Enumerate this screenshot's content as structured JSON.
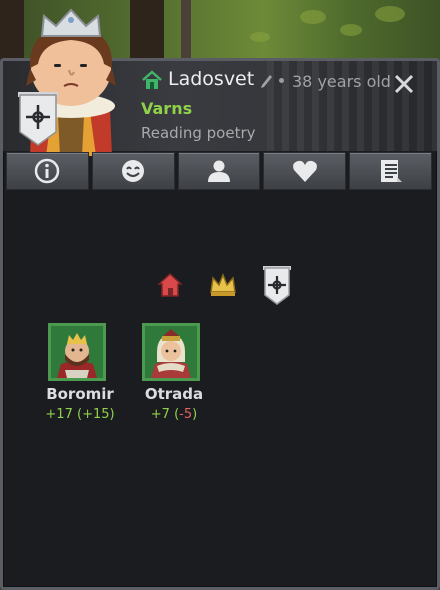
{
  "character": {
    "name": "Ladosvet",
    "age": "38 years old",
    "dynasty": "Varns",
    "activity": "Reading poetry"
  },
  "tabs": [
    {
      "icon": "info-icon"
    },
    {
      "icon": "mood-icon"
    },
    {
      "icon": "person-icon"
    },
    {
      "icon": "heart-icon"
    },
    {
      "icon": "scroll-icon"
    }
  ],
  "filters": [
    {
      "icon": "house-icon",
      "color": "#d9484a"
    },
    {
      "icon": "crown-icon",
      "color": "#e8c14a"
    },
    {
      "icon": "banner-icon",
      "color": "#e9eaec"
    }
  ],
  "members": [
    {
      "name": "Boromir",
      "score": "+17",
      "modifier_open": "(",
      "modifier": "+15",
      "modifier_close": ")",
      "modifier_color": "#8fd24a"
    },
    {
      "name": "Otrada",
      "score": "+7",
      "modifier_open": "(",
      "modifier": "-5",
      "modifier_close": ")",
      "modifier_color": "#e06262"
    }
  ],
  "colors": {
    "dynasty": "#8fd24a",
    "positive": "#8fd24a",
    "negative": "#e06262",
    "panel": "#1b1c20",
    "portrait_frame": "#2f7a3b"
  }
}
